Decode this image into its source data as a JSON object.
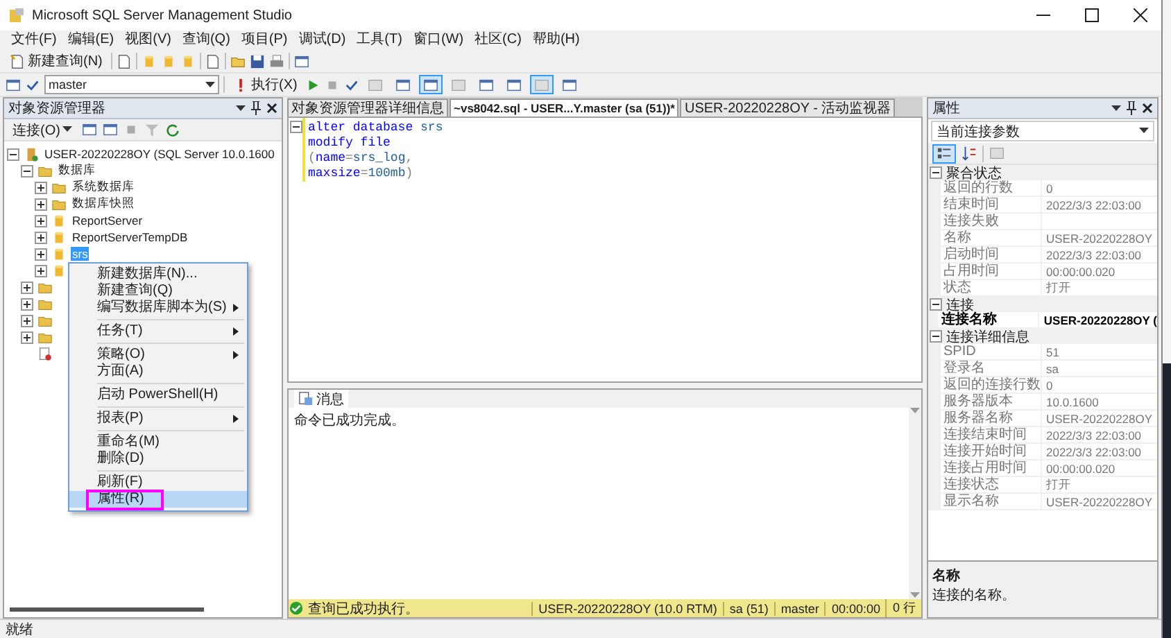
{
  "window": {
    "title": "Microsoft SQL Server Management Studio"
  },
  "menu": [
    "文件(F)",
    "编辑(E)",
    "视图(V)",
    "查询(Q)",
    "项目(P)",
    "调试(D)",
    "工具(T)",
    "窗口(W)",
    "社区(C)",
    "帮助(H)"
  ],
  "toolbar": {
    "new_query": "新建查询(N)"
  },
  "query_toolbar": {
    "database": "master",
    "execute": "执行(X)",
    "toggles": [
      {
        "pressed": false
      },
      {
        "pressed": false
      },
      {
        "pressed": true
      },
      {
        "pressed": false
      },
      {
        "pressed": false
      },
      {
        "pressed": false
      },
      {
        "pressed": true
      },
      {
        "pressed": false
      }
    ]
  },
  "object_explorer": {
    "title": "对象资源管理器",
    "connect": "连接(O)",
    "tree": [
      {
        "label": "USER-20220228OY (SQL Server 10.0.1600",
        "kind": "server",
        "expander": true,
        "expanded": true,
        "selected": false,
        "children": [
          {
            "label": "数据库",
            "kind": "folder",
            "expander": true,
            "expanded": true,
            "selected": false,
            "children": [
              {
                "label": "系统数据库",
                "kind": "folder",
                "expander": true,
                "expanded": false,
                "selected": false
              },
              {
                "label": "数据库快照",
                "kind": "folder",
                "expander": true,
                "expanded": false,
                "selected": false
              },
              {
                "label": "ReportServer",
                "kind": "database",
                "expander": true,
                "expanded": false,
                "selected": false
              },
              {
                "label": "ReportServerTempDB",
                "kind": "database",
                "expander": true,
                "expanded": false,
                "selected": false
              },
              {
                "label": "srs",
                "kind": "database",
                "expander": true,
                "expanded": false,
                "selected": true
              },
              {
                "kind": "database",
                "expander": true,
                "expanded": false
              }
            ]
          },
          {
            "kind": "folder",
            "expander": true,
            "expanded": false
          },
          {
            "kind": "folder",
            "expander": true,
            "expanded": false
          },
          {
            "kind": "folder",
            "expander": true,
            "expanded": false
          },
          {
            "kind": "folder",
            "expander": true,
            "expanded": false
          },
          {
            "kind": "agent",
            "expander": false
          }
        ]
      }
    ]
  },
  "context_menu": [
    {
      "kind": "item",
      "label": "新建数据库(N)...",
      "submenu": false,
      "selected": false,
      "annotated": false
    },
    {
      "kind": "item",
      "label": "新建查询(Q)",
      "submenu": false,
      "selected": false,
      "annotated": false
    },
    {
      "kind": "item",
      "label": "编写数据库脚本为(S)",
      "submenu": true,
      "selected": false,
      "annotated": false
    },
    {
      "kind": "separator"
    },
    {
      "kind": "item",
      "label": "任务(T)",
      "submenu": true,
      "selected": false,
      "annotated": false
    },
    {
      "kind": "separator"
    },
    {
      "kind": "item",
      "label": "策略(O)",
      "submenu": true,
      "selected": false,
      "annotated": false
    },
    {
      "kind": "item",
      "label": "方面(A)",
      "submenu": false,
      "selected": false,
      "annotated": false
    },
    {
      "kind": "separator"
    },
    {
      "kind": "item",
      "label": "启动 PowerShell(H)",
      "submenu": false,
      "selected": false,
      "annotated": false
    },
    {
      "kind": "separator"
    },
    {
      "kind": "item",
      "label": "报表(P)",
      "submenu": true,
      "selected": false,
      "annotated": false
    },
    {
      "kind": "separator"
    },
    {
      "kind": "item",
      "label": "重命名(M)",
      "submenu": false,
      "selected": false,
      "annotated": false
    },
    {
      "kind": "item",
      "label": "删除(D)",
      "submenu": false,
      "selected": false,
      "annotated": false
    },
    {
      "kind": "separator"
    },
    {
      "kind": "item",
      "label": "刷新(F)",
      "submenu": false,
      "selected": false,
      "annotated": false
    },
    {
      "kind": "item",
      "label": "属性(R)",
      "submenu": false,
      "selected": true,
      "annotated": true
    }
  ],
  "tabs": [
    {
      "label": "对象资源管理器详细信息",
      "selected": false
    },
    {
      "label": "~vs8042.sql - USER...Y.master (sa (51))*",
      "selected": true
    },
    {
      "label": "USER-20220228OY - 活动监视器",
      "selected": false
    }
  ],
  "editor": {
    "lines": [
      [
        {
          "text": "alter database",
          "kind": "keyword"
        },
        {
          "text": " srs",
          "kind": "name"
        }
      ],
      [
        {
          "text": "modify file",
          "kind": "keyword"
        }
      ],
      [
        {
          "text": "(",
          "kind": "punct"
        },
        {
          "text": "name",
          "kind": "keyword"
        },
        {
          "text": "=",
          "kind": "punct"
        },
        {
          "text": "srs_log",
          "kind": "name"
        },
        {
          "text": ",",
          "kind": "punct"
        }
      ],
      [
        {
          "text": "maxsize",
          "kind": "keyword"
        },
        {
          "text": "=",
          "kind": "punct"
        },
        {
          "text": "100mb",
          "kind": "name"
        },
        {
          "text": ")",
          "kind": "punct"
        }
      ]
    ]
  },
  "results": {
    "tab": "消息",
    "message": "命令已成功完成。"
  },
  "query_status": {
    "message": "查询已成功执行。",
    "segments": [
      "USER-20220228OY (10.0 RTM)",
      "sa (51)",
      "master",
      "00:00:00",
      "0 行"
    ]
  },
  "properties": {
    "title": "属性",
    "object": "当前连接参数",
    "categories": [
      {
        "name": "聚合状态",
        "expanded": true,
        "rows": [
          {
            "name": "返回的行数",
            "value": "0",
            "bold": false
          },
          {
            "name": "结束时间",
            "value": "2022/3/3 22:03:00",
            "bold": false
          },
          {
            "name": "连接失败",
            "bold": false
          },
          {
            "name": "名称",
            "value": "USER-20220228OY",
            "bold": false
          },
          {
            "name": "启动时间",
            "value": "2022/3/3 22:03:00",
            "bold": false
          },
          {
            "name": "占用时间",
            "value": "00:00:00.020",
            "bold": false
          },
          {
            "name": "状态",
            "value": "打开",
            "bold": false
          }
        ]
      },
      {
        "name": "连接",
        "expanded": true,
        "rows": [
          {
            "name": "连接名称",
            "value": "USER-20220228OY (",
            "bold": true
          }
        ]
      },
      {
        "name": "连接详细信息",
        "expanded": true,
        "rows": [
          {
            "name": "SPID",
            "value": "51",
            "bold": false
          },
          {
            "name": "登录名",
            "value": "sa",
            "bold": false
          },
          {
            "name": "返回的连接行数",
            "value": "0",
            "bold": false
          },
          {
            "name": "服务器版本",
            "value": "10.0.1600",
            "bold": false
          },
          {
            "name": "服务器名称",
            "value": "USER-20220228OY",
            "bold": false
          },
          {
            "name": "连接结束时间",
            "value": "2022/3/3 22:03:00",
            "bold": false
          },
          {
            "name": "连接开始时间",
            "value": "2022/3/3 22:03:00",
            "bold": false
          },
          {
            "name": "连接占用时间",
            "value": "00:00:00.020",
            "bold": false
          },
          {
            "name": "连接状态",
            "value": "打开",
            "bold": false
          },
          {
            "name": "显示名称",
            "value": "USER-20220228OY",
            "bold": false
          }
        ]
      }
    ],
    "description": {
      "title": "名称",
      "text": "连接的名称。"
    }
  },
  "status_bar": "就绪"
}
